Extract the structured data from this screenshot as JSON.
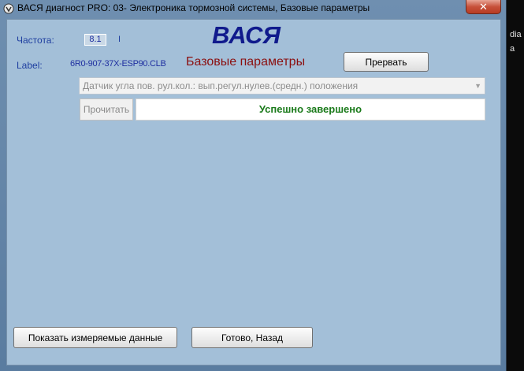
{
  "window": {
    "title": "ВАСЯ диагност PRO: 03- Электроника тормозной системы,  Базовые параметры",
    "close_label": "✕"
  },
  "header": {
    "logo": "ВАСЯ",
    "frequency_label": "Частота:",
    "frequency_value": "8.1",
    "frequency_tick": "I",
    "label_caption": "Label:",
    "label_value": "6R0-907-37X-ESP90.CLB",
    "section_title": "Базовые параметры",
    "abort_button": "Прервать"
  },
  "main": {
    "group_select": "Датчик угла пов. рул.кол.: вып.регул.нулев.(средн.) положения",
    "read_button": "Прочитать",
    "status": "Успешно завершено"
  },
  "footer": {
    "show_data_button": "Показать измеряемые данные",
    "done_button": "Готово, Назад"
  },
  "background": {
    "side_text_1": "dia",
    "side_text_2": "a"
  },
  "colors": {
    "client_bg": "#a3bfd8",
    "logo": "#101a8c",
    "section_title": "#8b0f0f",
    "status": "#1a7a1a"
  }
}
